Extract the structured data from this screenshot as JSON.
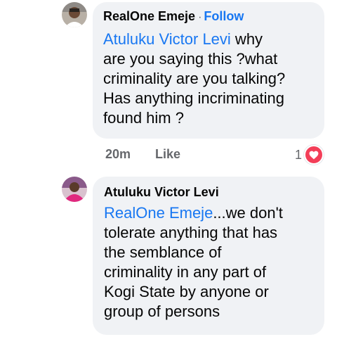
{
  "comments": [
    {
      "author": "RealOne Emeje",
      "follow_label": "Follow",
      "separator": "·",
      "mention": "Atuluku Victor Levi",
      "text_after_mention": "  why\nare you saying this ?what\ncriminality are you talking?\nHas anything incriminating\nfound him ?",
      "time": "20m",
      "like_label": "Like",
      "reaction_count": "1",
      "reaction_icon": "heart-icon",
      "avatar_icon": "user-photo-icon"
    },
    {
      "author": "Atuluku Victor Levi",
      "mention": "RealOne Emeje",
      "text_after_mention": "...we don't\ntolerate anything that has\nthe semblance of\ncriminality in any part of\nKogi State by anyone or\ngroup of persons",
      "avatar_icon": "user-photo-icon"
    }
  ],
  "colors": {
    "bubble": "#f0f2f5",
    "link": "#1877f2",
    "muted": "#65676b",
    "heart": "#f33e58"
  }
}
